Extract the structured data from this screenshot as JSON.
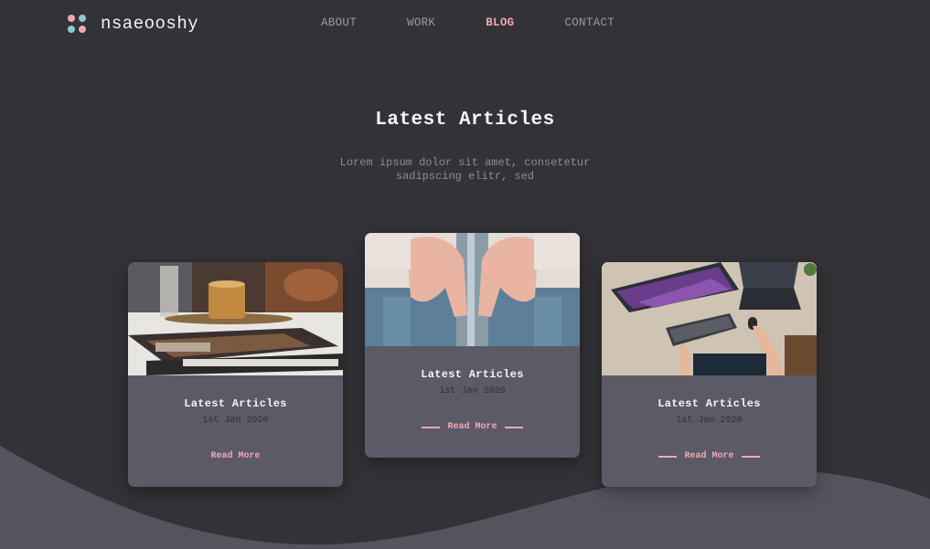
{
  "brand": {
    "name": "nsaeooshy",
    "dot_colors": [
      "#f2a7b4",
      "#8fc5d8",
      "#8fc5d8",
      "#f2a7b4"
    ]
  },
  "nav": {
    "items": [
      {
        "label": "ABOUT",
        "active": false
      },
      {
        "label": "WORK",
        "active": false
      },
      {
        "label": "BLOG",
        "active": true
      },
      {
        "label": "CONTACT",
        "active": false
      }
    ]
  },
  "hero": {
    "title": "Latest Articles",
    "subtitle": "Lorem ipsum dolor sit amet, consetetur sadipscing elitr, sed"
  },
  "cards": [
    {
      "title": "Latest Articles",
      "date": "1st Jan 2020",
      "link": "Read More",
      "image": "coffee-magazine-photo"
    },
    {
      "title": "Latest Articles",
      "date": "1st Jan 2020",
      "link": "Read More",
      "image": "hands-door-handle-photo"
    },
    {
      "title": "Latest Articles",
      "date": "1st Jan 2020",
      "link": "Read More",
      "image": "desk-computer-photo"
    }
  ],
  "colors": {
    "background": "#323237",
    "wave": "#55545e",
    "card": "#5b5a66",
    "accent": "#f2a7b4"
  }
}
